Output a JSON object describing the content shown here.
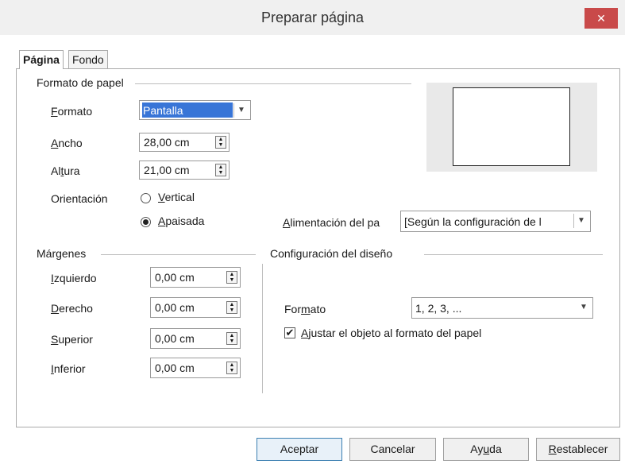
{
  "window": {
    "title": "Preparar página",
    "close_glyph": "✕"
  },
  "tabs": [
    {
      "label": "Página"
    },
    {
      "label": "Fondo"
    }
  ],
  "paper_format": {
    "heading": "Formato de papel",
    "format": {
      "label_pre": "",
      "label_u": "F",
      "label_post": "ormato",
      "value": "Pantalla"
    },
    "width": {
      "label_u": "A",
      "label_post": "ncho",
      "value": "28,00 cm"
    },
    "height": {
      "label_pre": "Al",
      "label_u": "t",
      "label_post": "ura",
      "value": "21,00 cm"
    },
    "orientation": {
      "label": "Orientación",
      "vertical": {
        "label_u": "V",
        "label_post": "ertical",
        "selected": false
      },
      "landscape": {
        "label_u": "A",
        "label_post": "paisada",
        "selected": true
      }
    },
    "paper_tray": {
      "label_u": "A",
      "label_post": "limentación del pa",
      "value": "[Según la configuración de l"
    }
  },
  "margins": {
    "heading": "Márgenes",
    "left": {
      "label_u": "I",
      "label_post": "zquierdo",
      "value": "0,00 cm"
    },
    "right": {
      "label_u": "D",
      "label_post": "erecho",
      "value": "0,00 cm"
    },
    "top": {
      "label_u": "S",
      "label_post": "uperior",
      "value": "0,00 cm"
    },
    "bottom": {
      "label_u": "I",
      "label_post": "nferior",
      "value": "0,00 cm"
    }
  },
  "layout": {
    "heading": "Configuración del diseño",
    "format": {
      "label_pre": "For",
      "label_u": "m",
      "label_post": "ato",
      "value": "1, 2, 3, ..."
    },
    "fit": {
      "label_u": "A",
      "label_post": "justar el objeto al formato del papel",
      "checked": true
    }
  },
  "buttons": {
    "ok": "Aceptar",
    "cancel": "Cancelar",
    "help_pre": "Ay",
    "help_u": "u",
    "help_post": "da",
    "reset_u": "R",
    "reset_post": "establecer"
  },
  "icons": {
    "spin": "spin-updown-icon",
    "dropdown": "chevron-down-icon",
    "check": "checkmark-icon"
  }
}
